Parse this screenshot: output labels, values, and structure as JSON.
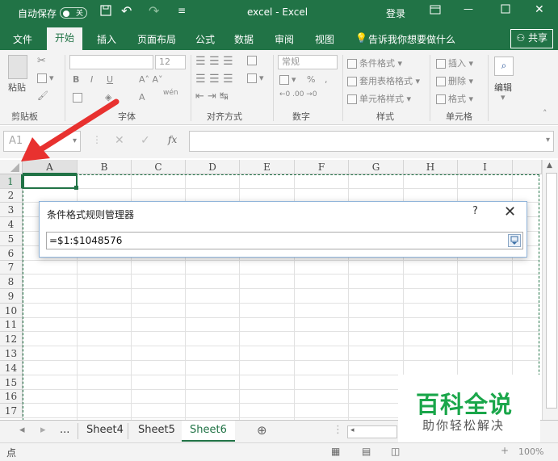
{
  "titlebar": {
    "autosave_label": "自动保存",
    "autosave_state": "关",
    "title": "excel  -  Excel",
    "login": "登录"
  },
  "tabs": [
    "文件",
    "开始",
    "插入",
    "页面布局",
    "公式",
    "数据",
    "审阅",
    "视图"
  ],
  "active_tab": "开始",
  "tell_me": "告诉我你想要做什么",
  "share": "共享",
  "ribbon": {
    "clipboard": {
      "label": "剪贴板",
      "paste": "粘贴"
    },
    "font": {
      "label": "字体",
      "size": "12"
    },
    "alignment": {
      "label": "对齐方式"
    },
    "number": {
      "label": "数字",
      "format": "常规",
      "percent": "%"
    },
    "styles": {
      "label": "样式",
      "items": [
        "条件格式",
        "套用表格格式",
        "单元格样式"
      ]
    },
    "cells": {
      "label": "单元格",
      "items": [
        "插入",
        "删除",
        "格式"
      ]
    },
    "editing": {
      "label": "编辑"
    }
  },
  "formula_bar": {
    "name_box": "A1",
    "fx": "fx",
    "content": ""
  },
  "grid": {
    "columns": [
      "A",
      "B",
      "C",
      "D",
      "E",
      "F",
      "G",
      "H",
      "I"
    ],
    "rows": [
      "1",
      "2",
      "3",
      "4",
      "5",
      "6",
      "7",
      "8",
      "9",
      "10",
      "11",
      "12",
      "13",
      "14",
      "15",
      "16",
      "17"
    ]
  },
  "dialog": {
    "title": "条件格式规则管理器",
    "help": "?",
    "close": "✕",
    "input_value": "=$1:$1048576"
  },
  "sheets": [
    "Sheet4",
    "Sheet5",
    "Sheet6"
  ],
  "active_sheet": "Sheet6",
  "sheet_more": "...",
  "status": {
    "mode": "点",
    "zoom": "100%"
  },
  "watermark": {
    "title": "百科全说",
    "subtitle": "助你轻松解决"
  },
  "colors": {
    "excel_green": "#217346",
    "arrow_red": "#e8312f",
    "watermark_green": "#1aa64a"
  }
}
